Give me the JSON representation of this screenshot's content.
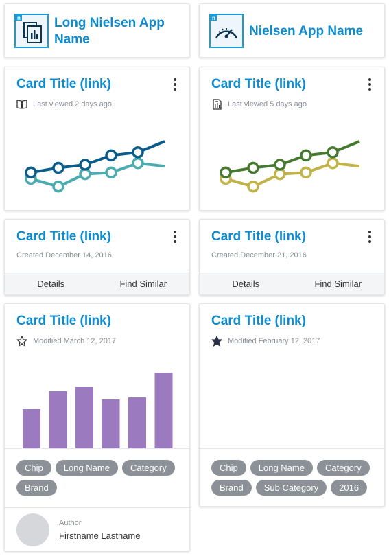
{
  "apps": [
    {
      "name": "Long Nielsen App Name",
      "icon": "report-grid-icon"
    },
    {
      "name": "Nielsen App Name",
      "icon": "gauge-icon"
    }
  ],
  "cards": {
    "chart_card_1": {
      "title": "Card Title (link)",
      "meta": "Last viewed 2 days ago",
      "icon": "book-icon"
    },
    "chart_card_2": {
      "title": "Card Title (link)",
      "meta": "Last viewed 5 days ago",
      "icon": "document-icon"
    },
    "action_card_1": {
      "title": "Card Title (link)",
      "meta": "Created December 14, 2016",
      "details": "Details",
      "find": "Find Similar"
    },
    "action_card_2": {
      "title": "Card Title (link)",
      "meta": "Created December 21, 2016",
      "details": "Details",
      "find": "Find Similar"
    },
    "tag_card_1": {
      "title": "Card Title (link)",
      "meta": "Modified March 12, 2017",
      "favorite": false,
      "chips": [
        "Chip",
        "Long Name",
        "Category",
        "Brand"
      ],
      "author_label": "Author",
      "author_name": "Firstname Lastname"
    },
    "tag_card_2": {
      "title": "Card Title (link)",
      "meta": "Modified February 12, 2017",
      "favorite": true,
      "chips": [
        "Chip",
        "Long Name",
        "Category",
        "Brand",
        "Sub Category",
        "2016"
      ]
    }
  },
  "colors": {
    "link": "#0c8bd0",
    "chart1_series1": "#0a5c8a",
    "chart1_series2": "#4aabb0",
    "chart2_series1": "#45792f",
    "chart2_series2": "#c2b348",
    "bar": "#9b7abf",
    "chip": "#8b9196"
  },
  "chart_data": [
    {
      "type": "line",
      "series": [
        {
          "values": [
            2.0,
            2.3,
            2.5,
            3.1,
            3.3,
            4.0
          ]
        },
        {
          "values": [
            1.6,
            1.1,
            1.9,
            2.0,
            2.6,
            2.4
          ]
        }
      ]
    },
    {
      "type": "line",
      "series": [
        {
          "values": [
            2.0,
            2.3,
            2.5,
            3.1,
            3.3,
            4.0
          ]
        },
        {
          "values": [
            1.6,
            1.1,
            1.9,
            2.0,
            2.6,
            2.4
          ]
        }
      ]
    },
    {
      "type": "bar",
      "values": [
        57,
        83,
        89,
        71,
        74,
        110
      ]
    }
  ]
}
